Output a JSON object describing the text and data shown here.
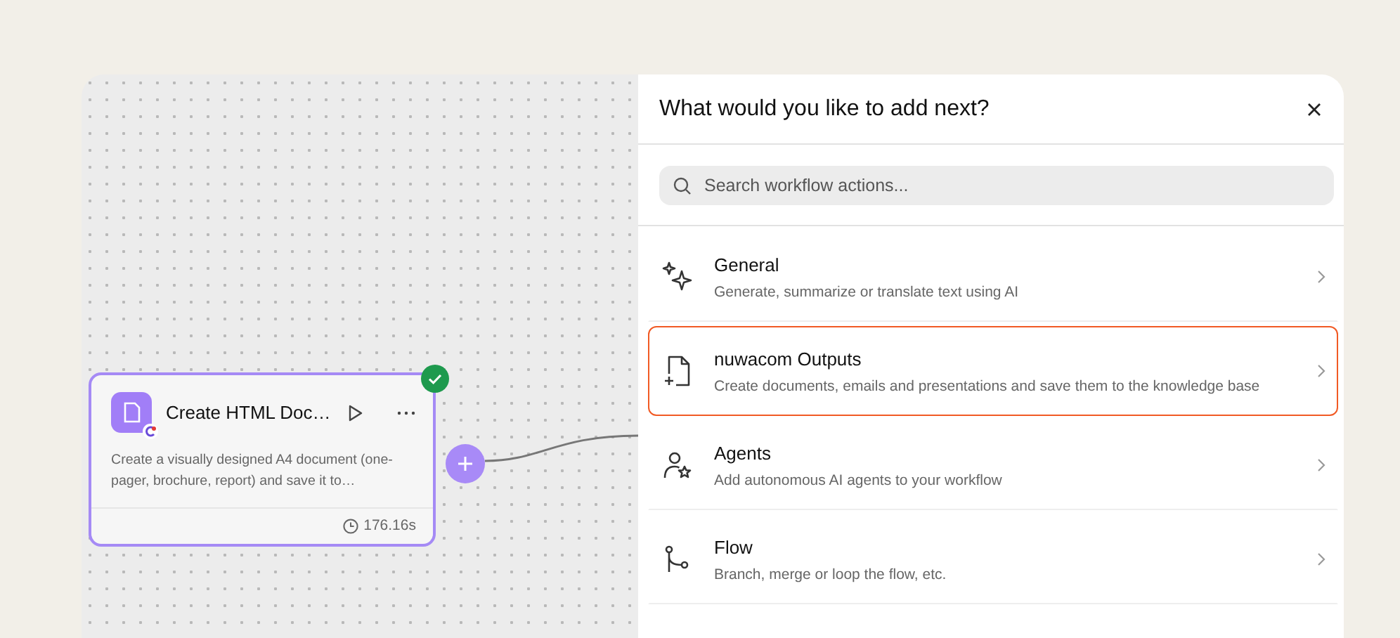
{
  "canvas": {
    "node": {
      "title": "Create HTML Doc…",
      "description": "Create a visually designed A4 document (one-pager, brochure, report) and save it to…",
      "duration": "176.16s",
      "done": true
    }
  },
  "panel": {
    "title": "What would you like to add next?",
    "search": {
      "placeholder": "Search workflow actions..."
    },
    "items": [
      {
        "title": "General",
        "description": "Generate, summarize or translate text using AI",
        "selected": false
      },
      {
        "title": "nuwacom Outputs",
        "description": "Create documents, emails and presentations and save them to the knowledge base",
        "selected": true
      },
      {
        "title": "Agents",
        "description": "Add autonomous AI agents to your workflow",
        "selected": false
      },
      {
        "title": "Flow",
        "description": "Branch, merge or loop the flow, etc.",
        "selected": false
      }
    ]
  }
}
